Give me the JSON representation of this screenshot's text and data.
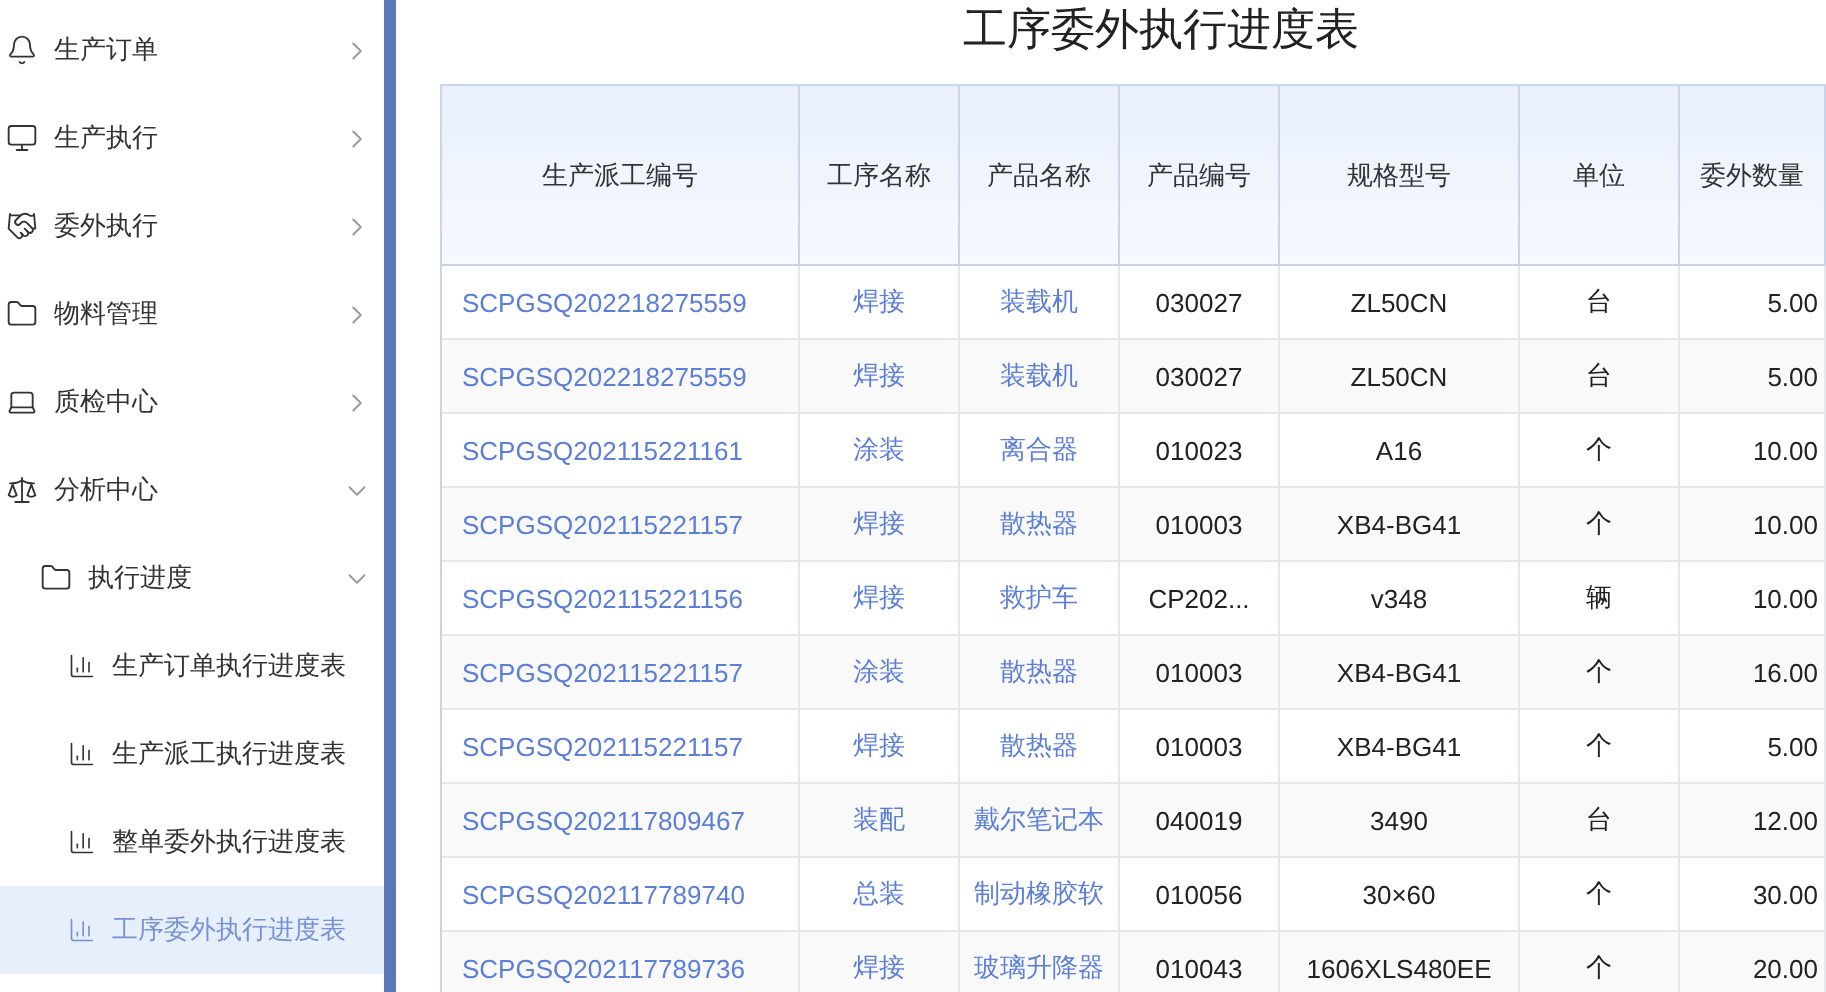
{
  "sidebar": {
    "items": [
      {
        "label": "生产订单",
        "expanded": false,
        "selected": false
      },
      {
        "label": "生产执行",
        "expanded": false,
        "selected": false
      },
      {
        "label": "委外执行",
        "expanded": false,
        "selected": false
      },
      {
        "label": "物料管理",
        "expanded": false,
        "selected": false
      },
      {
        "label": "质检中心",
        "expanded": false,
        "selected": false
      },
      {
        "label": "分析中心",
        "expanded": true,
        "selected": false,
        "children": [
          {
            "label": "执行进度",
            "expanded": true,
            "selected": false,
            "children": [
              {
                "label": "生产订单执行进度表",
                "selected": false
              },
              {
                "label": "生产派工执行进度表",
                "selected": false
              },
              {
                "label": "整单委外执行进度表",
                "selected": false
              },
              {
                "label": "工序委外执行进度表",
                "selected": true
              }
            ]
          }
        ]
      }
    ]
  },
  "page_title": "工序委外执行进度表",
  "table": {
    "columns": [
      {
        "label": "生产派工编号",
        "kind": "link"
      },
      {
        "label": "工序名称",
        "kind": "link"
      },
      {
        "label": "产品名称",
        "kind": "link"
      },
      {
        "label": "产品编号",
        "kind": "text"
      },
      {
        "label": "规格型号",
        "kind": "text"
      },
      {
        "label": "单位",
        "kind": "text"
      },
      {
        "label": "委外数量",
        "kind": "number"
      }
    ],
    "rows": [
      [
        "SCPGSQ202218275559",
        "焊接",
        "装载机",
        "030027",
        "ZL50CN",
        "台",
        "5.00"
      ],
      [
        "SCPGSQ202218275559",
        "焊接",
        "装载机",
        "030027",
        "ZL50CN",
        "台",
        "5.00"
      ],
      [
        "SCPGSQ202115221161",
        "涂装",
        "离合器",
        "010023",
        "A16",
        "个",
        "10.00"
      ],
      [
        "SCPGSQ202115221157",
        "焊接",
        "散热器",
        "010003",
        "XB4-BG41",
        "个",
        "10.00"
      ],
      [
        "SCPGSQ202115221156",
        "焊接",
        "救护车",
        "CP202...",
        "v348",
        "辆",
        "10.00"
      ],
      [
        "SCPGSQ202115221157",
        "涂装",
        "散热器",
        "010003",
        "XB4-BG41",
        "个",
        "16.00"
      ],
      [
        "SCPGSQ202115221157",
        "焊接",
        "散热器",
        "010003",
        "XB4-BG41",
        "个",
        "5.00"
      ],
      [
        "SCPGSQ202117809467",
        "装配",
        "戴尔笔记本",
        "040019",
        "3490",
        "台",
        "12.00"
      ],
      [
        "SCPGSQ202117789740",
        "总装",
        "制动橡胶软",
        "010056",
        "30×60",
        "个",
        "30.00"
      ],
      [
        "SCPGSQ202117789736",
        "焊接",
        "玻璃升降器",
        "010043",
        "1606XLS480EE",
        "个",
        "20.00"
      ]
    ]
  }
}
